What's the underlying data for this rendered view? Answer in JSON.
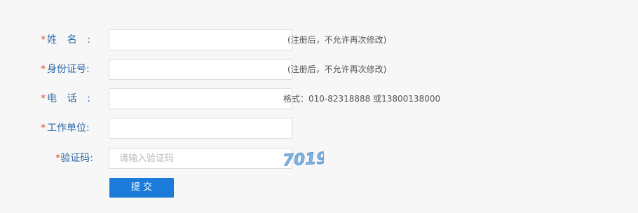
{
  "form": {
    "required_mark": "*",
    "fields": [
      {
        "label": "姓 名:",
        "label_left": "姓",
        "label_right": "名:",
        "value": "",
        "placeholder": "",
        "hint": "(注册后，不允许再次修改)"
      },
      {
        "label": "身份证号:",
        "value": "",
        "placeholder": "",
        "hint": "(注册后，不允许再次修改)"
      },
      {
        "label": "电 话:",
        "label_left": "电",
        "label_right": "话:",
        "value": "",
        "placeholder": "",
        "hint": "格式：010-82318888 或13800138000"
      },
      {
        "label": "工作单位:",
        "value": "",
        "placeholder": ""
      }
    ],
    "captcha": {
      "label": "验证码:",
      "value": "",
      "placeholder": "请输入验证码",
      "image_text": "7019"
    },
    "submit_label": "提交"
  },
  "colors": {
    "label": "#2e6aa8",
    "required": "#e24b2b",
    "button": "#1b7bd8",
    "captcha_text": "#6fa8dc"
  }
}
